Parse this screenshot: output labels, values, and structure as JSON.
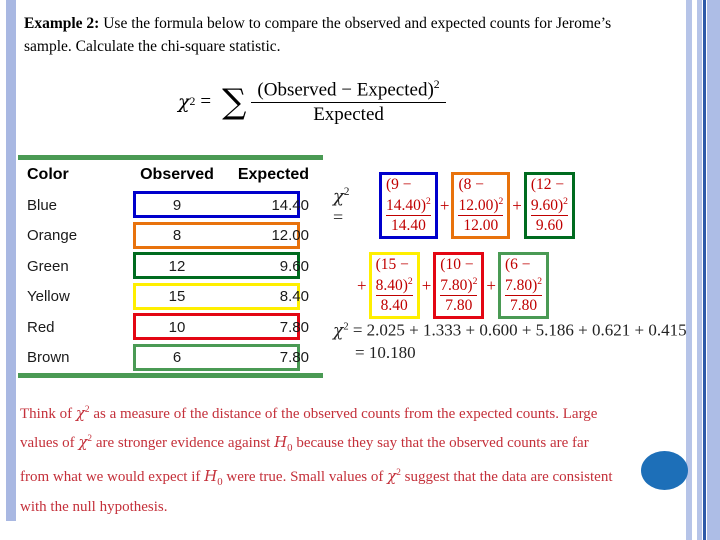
{
  "slide": {
    "header": {
      "lead": "Example 2:",
      "body": " Use the formula below to compare the observed and expected counts for Jerome’s sample.  Calculate the chi-square statistic."
    },
    "main_formula": {
      "chi": "χ",
      "exponent": "2",
      "equals": "=",
      "sigma": "∑",
      "numerator": "(Observed  −  Expected)",
      "numerator_exponent": "2",
      "denominator": "Expected"
    },
    "table": {
      "headers": [
        "Color",
        "Observed",
        "Expected"
      ],
      "rows": [
        {
          "color": "Blue",
          "observed": "9",
          "expected": "14.40",
          "outline": "#0000cc"
        },
        {
          "color": "Orange",
          "observed": "8",
          "expected": "12.00",
          "outline": "#e8720c"
        },
        {
          "color": "Green",
          "observed": "12",
          "expected": "9.60",
          "outline": "#006b1f"
        },
        {
          "color": "Yellow",
          "observed": "15",
          "expected": "8.40",
          "outline": "#ffef00"
        },
        {
          "color": "Red",
          "observed": "10",
          "expected": "7.80",
          "outline": "#e30613"
        },
        {
          "color": "Brown",
          "observed": "6",
          "expected": "7.80",
          "outline": "#4a9a54"
        }
      ],
      "rule_color": "#4a9a54"
    },
    "expansion": {
      "chi": "χ",
      "exponent": "2",
      "equals": "=",
      "terms": [
        {
          "numerator": "(9 − 14.40)",
          "exponent": "2",
          "denominator": "14.40",
          "outline": "#0000cc"
        },
        {
          "numerator": "(8 − 12.00)",
          "exponent": "2",
          "denominator": "12.00",
          "outline": "#e8720c"
        },
        {
          "numerator": "(12 − 9.60)",
          "exponent": "2",
          "denominator": "9.60",
          "outline": "#006b1f"
        },
        {
          "numerator": "(15 − 8.40)",
          "exponent": "2",
          "denominator": "8.40",
          "outline": "#ffef00"
        },
        {
          "numerator": "(10 − 7.80)",
          "exponent": "2",
          "denominator": "7.80",
          "outline": "#e30613"
        },
        {
          "numerator": "(6 − 7.80)",
          "exponent": "2",
          "denominator": "7.80",
          "outline": "#4a9a54"
        }
      ],
      "plus": "+"
    },
    "result": {
      "line1": "= 2.025 + 1.333 + 0.600 + 5.186 + 0.621 + 0.415",
      "line2": "= 10.180",
      "chi": "χ",
      "exponent": "2"
    },
    "note": {
      "part1": "Think of ",
      "chi": "χ",
      "exp": "2",
      "part2": " as a measure of the distance of the observed counts from the expected counts. Large values of ",
      "part3": " are stronger evidence against ",
      "h": "H",
      "h_sub": "0",
      "part4": " because they say that the observed counts are far from what we would expect if ",
      "part5": " were true. Small values of ",
      "part6": " suggest that the data are consistent with the null hypothesis."
    },
    "decoration": {
      "circle_color": "#1d6fb8",
      "left_strip_color": "#a9b8e2",
      "right_strip_color": "#b6c4e8",
      "right_accent_color": "#2e5aa8"
    }
  }
}
